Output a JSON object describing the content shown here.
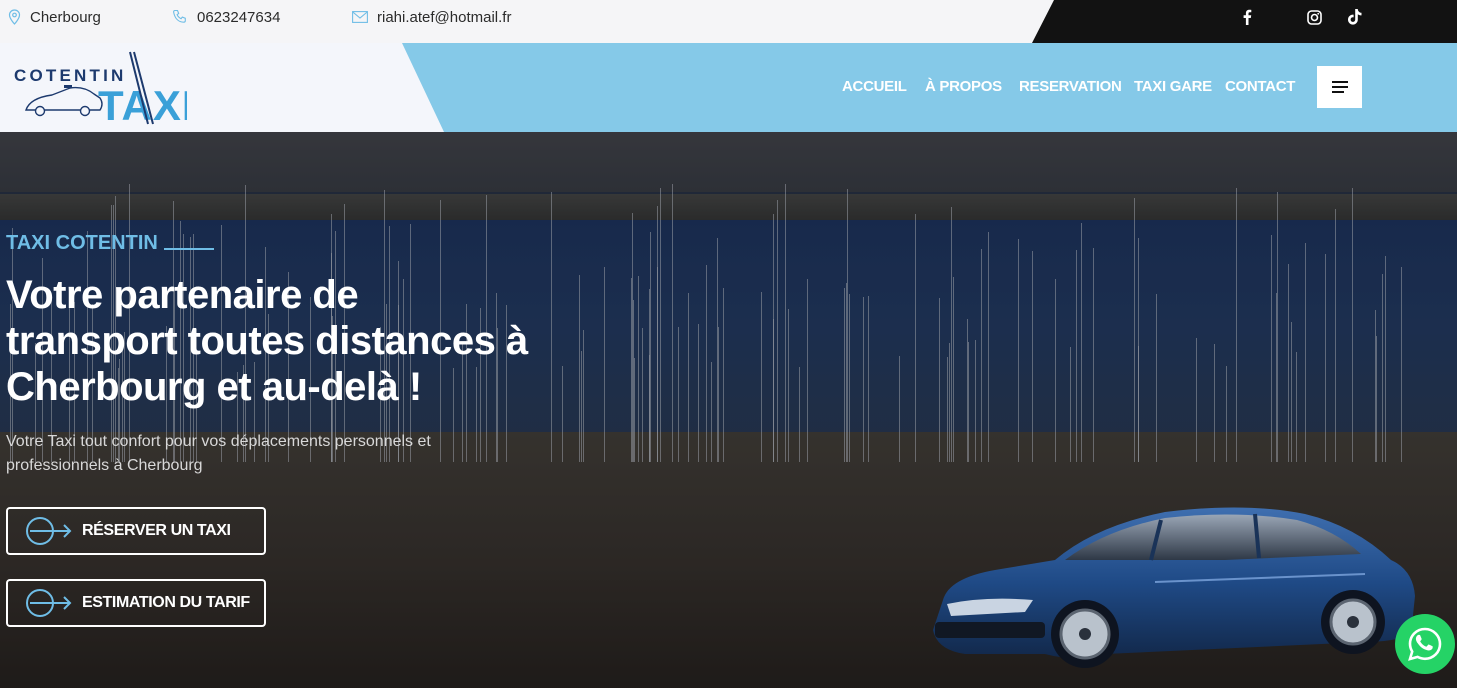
{
  "topbar": {
    "location": "Cherbourg",
    "phone": "0623247634",
    "email": "riahi.atef@hotmail.fr",
    "icons": [
      "map-pin-icon",
      "phone-icon",
      "mail-icon"
    ],
    "social": [
      "facebook-icon",
      "instagram-icon",
      "tiktok-icon"
    ]
  },
  "logo": {
    "line1": "COTENTIN",
    "line2": "TAXI"
  },
  "nav": {
    "items": [
      {
        "label": "ACCUEIL"
      },
      {
        "label": "À PROPOS"
      },
      {
        "label": "RESERVATION"
      },
      {
        "label": "TAXI GARE"
      },
      {
        "label": "CONTACT"
      }
    ],
    "menu_icon": "hamburger-icon"
  },
  "hero": {
    "tagline": "TAXI COTENTIN",
    "title_line1": "Votre partenaire de",
    "title_line2": "transport toutes distances à",
    "title_line3": "Cherbourg et au-delà !",
    "subtitle_line1": "Votre Taxi tout confort pour vos déplacements personnels et",
    "subtitle_line2": "professionnels à Cherbourg",
    "cta_primary": "RÉSERVER UN TAXI",
    "cta_secondary": "ESTIMATION DU TARIF",
    "cta_icon": "arrow-circle-icon"
  },
  "whatsapp": {
    "icon": "whatsapp-icon"
  },
  "colors": {
    "accent": "#85c9e8",
    "accent_text": "#6fbde6",
    "dark": "#121212",
    "whatsapp": "#25d366"
  }
}
